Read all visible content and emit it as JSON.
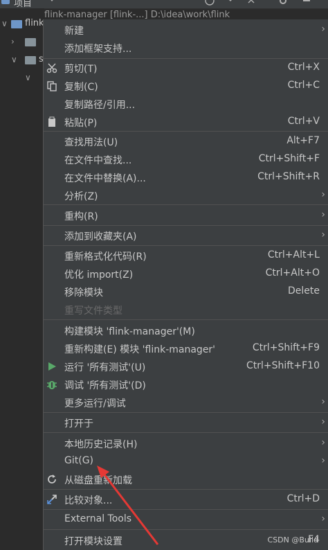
{
  "topbar": {
    "title": "项目"
  },
  "tree": [
    {
      "label": "flink",
      "level": 0,
      "expanded": true,
      "type": "module"
    },
    {
      "label": "",
      "level": 1,
      "expanded": false,
      "type": "folder"
    },
    {
      "label": "s",
      "level": 1,
      "expanded": false,
      "type": "folder"
    },
    {
      "label": "",
      "level": 2,
      "expanded": true,
      "type": "none"
    }
  ],
  "background_text": "flink-manager [flink-...] D:\\idea\\work\\flink",
  "menu": {
    "new": {
      "label": "新建",
      "sub": "›"
    },
    "add_framework": {
      "label": "添加框架支持..."
    },
    "cut": {
      "label": "剪切(T)",
      "shortcut": "Ctrl+X"
    },
    "copy": {
      "label": "复制(C)",
      "shortcut": "Ctrl+C"
    },
    "copy_path": {
      "label": "复制路径/引用..."
    },
    "paste": {
      "label": "粘贴(P)",
      "shortcut": "Ctrl+V"
    },
    "find_usages": {
      "label": "查找用法(U)",
      "shortcut": "Alt+F7"
    },
    "find_in_files": {
      "label": "在文件中查找...",
      "shortcut": "Ctrl+Shift+F"
    },
    "replace_in_files": {
      "label": "在文件中替换(A)...",
      "shortcut": "Ctrl+Shift+R"
    },
    "analyze": {
      "label": "分析(Z)",
      "sub": "›"
    },
    "refactor": {
      "label": "重构(R)",
      "sub": "›"
    },
    "add_favorites": {
      "label": "添加到收藏夹(A)",
      "sub": "›"
    },
    "reformat": {
      "label": "重新格式化代码(R)",
      "shortcut": "Ctrl+Alt+L"
    },
    "optimize_imports": {
      "label": "优化 import(Z)",
      "shortcut": "Ctrl+Alt+O"
    },
    "remove_module": {
      "label": "移除模块",
      "shortcut": "Delete"
    },
    "override_filetype": {
      "label": "重写文件类型"
    },
    "build_module": {
      "label": "构建模块 'flink-manager'(M)"
    },
    "rebuild_module": {
      "label": "重新构建(E) 模块 'flink-manager'",
      "shortcut": "Ctrl+Shift+F9"
    },
    "run_tests": {
      "label": "运行 '所有测试'(U)",
      "shortcut": "Ctrl+Shift+F10"
    },
    "debug_tests": {
      "label": "调试 '所有测试'(D)"
    },
    "more_run": {
      "label": "更多运行/调试",
      "sub": "›"
    },
    "open_in": {
      "label": "打开于",
      "sub": "›"
    },
    "local_history": {
      "label": "本地历史记录(H)",
      "sub": "›"
    },
    "git": {
      "label": "Git(G)",
      "sub": "›"
    },
    "reload_from_disk": {
      "label": "从磁盘重新加载"
    },
    "compare_with": {
      "label": "比较对象...",
      "shortcut": "Ctrl+D"
    },
    "external_tools": {
      "label": "External Tools",
      "sub": "›"
    },
    "module_settings": {
      "label": "打开模块设置",
      "shortcut": "F4"
    }
  },
  "watermark": "CSDN @Build",
  "colors": {
    "menu_bg": "#3c3f41",
    "separator": "#515151",
    "text": "#c8c8c8",
    "disabled": "#6a6a6a",
    "run_green": "#59a869",
    "debug_green": "#59a869",
    "arrow_red": "#e53935"
  },
  "icons": [
    "scissors-icon",
    "copy-icon",
    "paste-icon",
    "run-icon",
    "debug-icon",
    "reload-icon",
    "compare-icon"
  ]
}
